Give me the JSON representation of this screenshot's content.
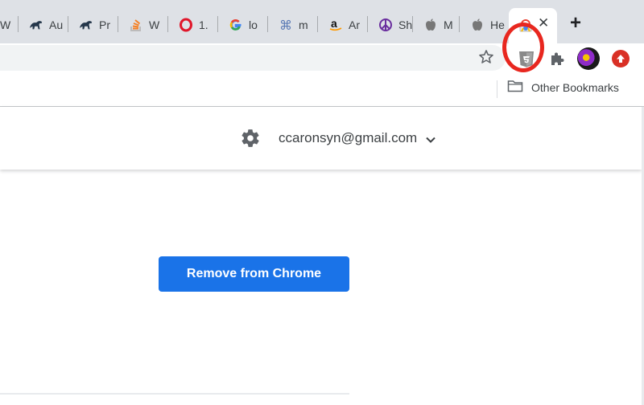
{
  "tabs": [
    {
      "title": "W",
      "icon": "partial-favicon"
    },
    {
      "title": "Au",
      "icon": "dinosaur-icon"
    },
    {
      "title": "Pr",
      "icon": "dinosaur-icon"
    },
    {
      "title": "W",
      "icon": "stackoverflow-icon"
    },
    {
      "title": "1.",
      "icon": "opera-icon"
    },
    {
      "title": "lo",
      "icon": "google-icon"
    },
    {
      "title": "m",
      "icon": "command-key-icon"
    },
    {
      "title": "Ar",
      "icon": "amazon-icon"
    },
    {
      "title": "Sh",
      "icon": "peace-icon"
    },
    {
      "title": "M",
      "icon": "apple-icon"
    },
    {
      "title": "He",
      "icon": "apple-icon"
    }
  ],
  "active_tab": {
    "icon": "chrome-web-store-icon",
    "close_glyph": "✕"
  },
  "new_tab_glyph": "+",
  "toolbar": {
    "bookmark_star_icon": "star-outline-icon",
    "extension_icon": "shield-extension-icon",
    "extensions_icon": "puzzle-icon",
    "profile_icon": "avatar",
    "update_icon": "update-arrow-icon",
    "highlight_color": "#e8271f"
  },
  "bookmarks_bar": {
    "other_bookmarks_label": "Other Bookmarks",
    "folder_icon": "folder-icon"
  },
  "store_header": {
    "settings_icon": "gear-icon",
    "account_email": "ccaronsyn@gmail.com",
    "account_menu_icon": "chevron-down-icon"
  },
  "main": {
    "remove_button_label": "Remove from Chrome",
    "remove_button_color": "#1a73e8"
  }
}
